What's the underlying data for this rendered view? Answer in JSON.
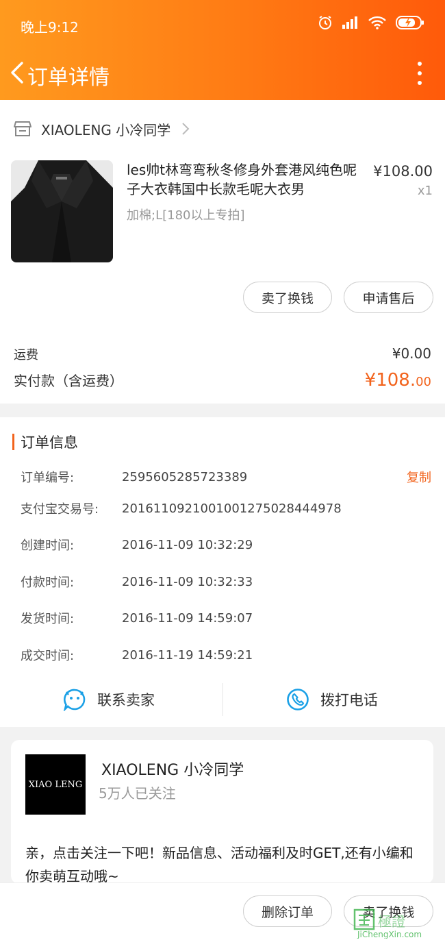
{
  "status_bar": {
    "time": "晚上9:12"
  },
  "nav": {
    "title": "订单详情"
  },
  "shop": {
    "name": "XIAOLENG 小冷同学"
  },
  "product": {
    "title": "les帅t林弯弯秋冬修身外套港风纯色呢子大衣韩国中长款毛呢大衣男",
    "spec": "加棉;L[180以上专拍]",
    "price": "¥108.00",
    "qty": "x1"
  },
  "actions": {
    "sell_label": "卖了换钱",
    "aftersale_label": "申请售后"
  },
  "fees": {
    "shipping_label": "运费",
    "shipping_value": "¥0.00",
    "paid_label": "实付款（含运费）",
    "paid_main": "¥108.",
    "paid_cents": "00"
  },
  "order_info": {
    "title": "订单信息",
    "copy_label": "复制",
    "rows": [
      {
        "label": "订单编号:",
        "value": "2595605285723389"
      },
      {
        "label": "支付宝交易号:",
        "value": "2016110921001001275028444978"
      },
      {
        "label": "创建时间:",
        "value": "2016-11-09 10:32:29"
      },
      {
        "label": "付款时间:",
        "value": "2016-11-09 10:32:33"
      },
      {
        "label": "发货时间:",
        "value": "2016-11-09 14:59:07"
      },
      {
        "label": "成交时间:",
        "value": "2016-11-19 14:59:21"
      }
    ]
  },
  "contact": {
    "seller_label": "联系卖家",
    "phone_label": "拨打电话"
  },
  "store_card": {
    "logo_text": "XIAO LENG",
    "name": "XIAOLENG 小冷同学",
    "followers": "5万人已关注",
    "message": "亲，点击关注一下吧！新品信息、活动福利及时GET,还有小编和你卖萌互动哦~"
  },
  "bottom": {
    "delete_label": "删除订单",
    "sell_label": "卖了换钱"
  },
  "watermark": {
    "text": "JiChengXin.com"
  },
  "colors": {
    "accent": "#f2631c",
    "header_start": "#ff9a1e",
    "header_end": "#ff5a0a",
    "contact_icon": "#1aa0e6"
  }
}
